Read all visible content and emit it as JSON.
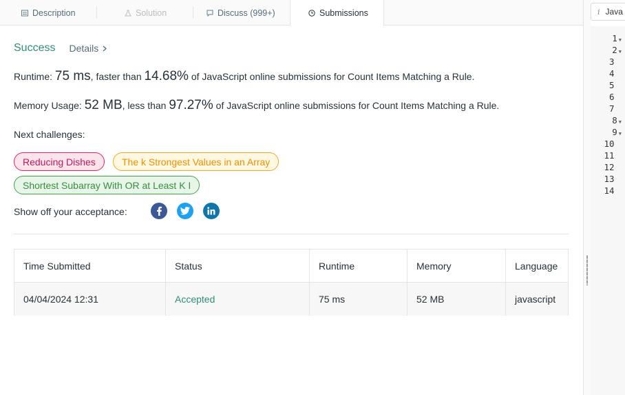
{
  "tabs": [
    {
      "label": "Description",
      "icon": "description-icon"
    },
    {
      "label": "Solution",
      "icon": "flask-icon"
    },
    {
      "label": "Discuss (999+)",
      "icon": "comment-icon"
    },
    {
      "label": "Submissions",
      "icon": "clock-icon"
    }
  ],
  "result": {
    "status": "Success",
    "details": "Details",
    "runtime_label": "Runtime: ",
    "runtime_value": "75 ms",
    "runtime_mid": ", faster than ",
    "runtime_pct": "14.68%",
    "runtime_tail": " of JavaScript online submissions for Count Items Matching a Rule.",
    "memory_label": "Memory Usage: ",
    "memory_value": "52 MB",
    "memory_mid": ", less than ",
    "memory_pct": "97.27%",
    "memory_tail": " of JavaScript online submissions for Count Items Matching a Rule."
  },
  "next_challenges": {
    "label": "Next challenges:",
    "items": [
      {
        "title": "Reducing Dishes",
        "difficulty": "hard"
      },
      {
        "title": "The k Strongest Values in an Array",
        "difficulty": "medium"
      },
      {
        "title": "Shortest Subarray With OR at Least K I",
        "difficulty": "easy"
      }
    ]
  },
  "share_label": "Show off your acceptance:",
  "table": {
    "headers": [
      "Time Submitted",
      "Status",
      "Runtime",
      "Memory",
      "Language"
    ],
    "rows": [
      [
        "04/04/2024 12:31",
        "Accepted",
        "75 ms",
        "52 MB",
        "javascript"
      ]
    ]
  },
  "editor": {
    "language": "Java",
    "line_numbers": [
      "1",
      "2",
      "3",
      "4",
      "5",
      "6",
      "7",
      "8",
      "9",
      "10",
      "11",
      "12",
      "13",
      "14"
    ]
  },
  "colors": {
    "success": "#2d8f75",
    "hard": "#e91e63",
    "medium": "#f5a623",
    "easy": "#43a047",
    "facebook": "#3b5998",
    "twitter": "#1da1f2",
    "linkedin": "#0e76a8"
  }
}
